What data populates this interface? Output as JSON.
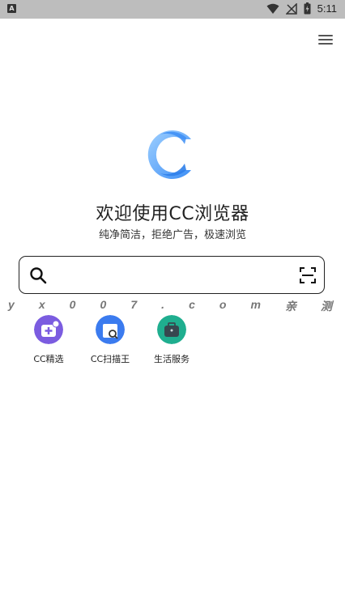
{
  "status_bar": {
    "time": "5:11",
    "left_icon_letter": "A",
    "icons": [
      "app-notification-icon",
      "wifi-icon",
      "no-signal-icon",
      "battery-charging-icon"
    ]
  },
  "header": {
    "menu_icon": "hamburger-menu-icon"
  },
  "hero": {
    "logo": "cc-browser-logo",
    "title": "欢迎使用CC浏览器",
    "subtitle": "纯净简洁，拒绝广告，极速浏览"
  },
  "search": {
    "value": "",
    "placeholder": "",
    "search_icon": "search-icon",
    "scan_icon": "scan-icon"
  },
  "watermark": {
    "chars": [
      "y",
      "x",
      "0",
      "0",
      "7",
      ".",
      "c",
      "o",
      "m",
      "亲",
      "测"
    ]
  },
  "shortcuts": [
    {
      "label": "CC精选",
      "icon": "cc-featured-icon",
      "color": "#7b5ce0"
    },
    {
      "label": "CC扫描王",
      "icon": "cc-scanner-icon",
      "color": "#3b7bef"
    },
    {
      "label": "生活服务",
      "icon": "life-services-icon",
      "color": "#1fae8f"
    }
  ],
  "colors": {
    "logo_blue": "#3d8ef5",
    "logo_light": "#9fd0ff",
    "status_bar_bg": "#bdbdbd"
  }
}
